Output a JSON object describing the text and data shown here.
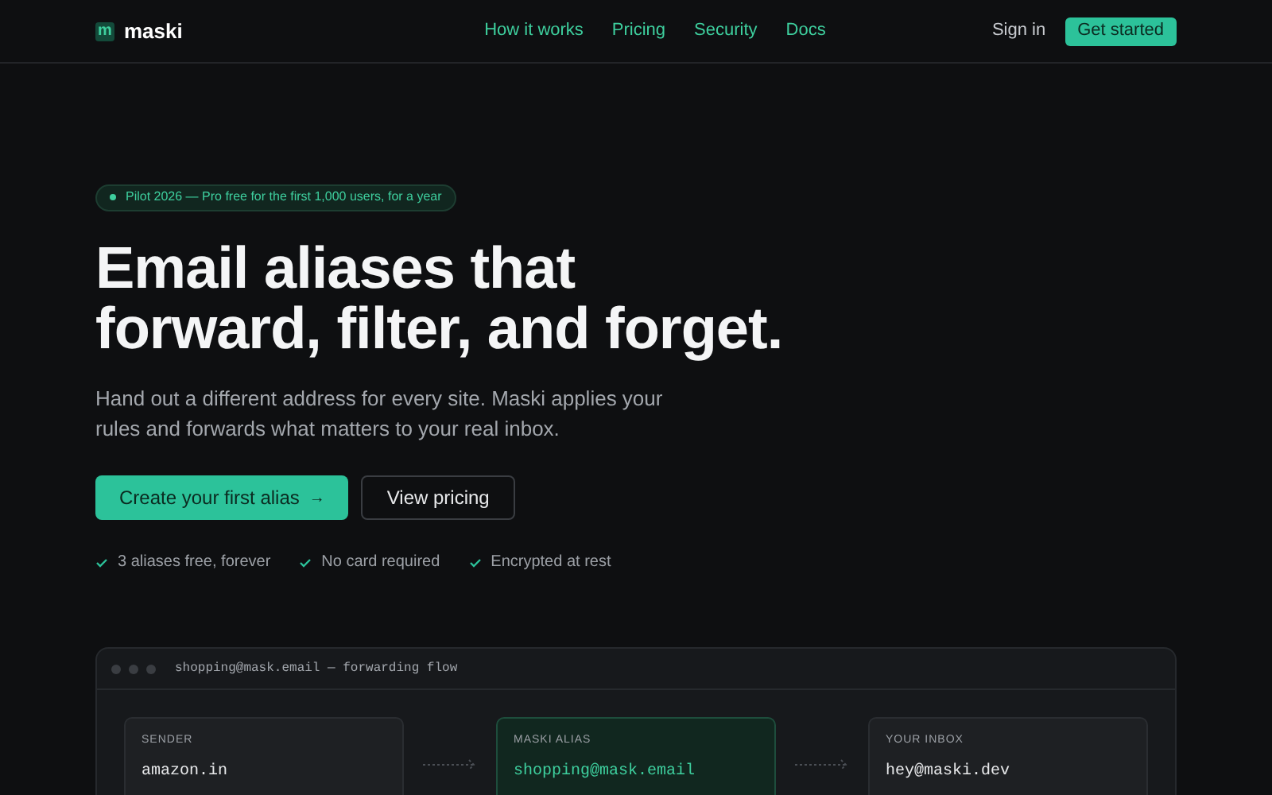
{
  "nav": {
    "logo_mark": "m",
    "brand": "maski",
    "links": [
      "How it works",
      "Pricing",
      "Security",
      "Docs"
    ],
    "sign_in": "Sign in",
    "cta": "Get started"
  },
  "hero": {
    "badge": "Pilot 2026 — Pro free for the first 1,000 users, for a year",
    "title_lines": [
      "Email aliases that",
      "forward, filter, and forget."
    ],
    "subtitle_lines": [
      "Hand out a different address for every site. Maski applies your",
      "rules and forwards what matters to your real inbox."
    ],
    "primary_button": {
      "label": "Create your first alias",
      "arrow": "→"
    },
    "secondary_button": "View pricing",
    "checks": [
      "3 aliases free, forever",
      "No card required",
      "Encrypted at rest"
    ]
  },
  "flow_panel": {
    "title": "shopping@mask.email — forwarding flow",
    "cards": [
      {
        "label": "SENDER",
        "value": "amazon.in",
        "highlighted": false
      },
      {
        "label": "MASKI ALIAS",
        "value": "shopping@mask.email",
        "highlighted": true
      },
      {
        "label": "YOUR INBOX",
        "value": "hey@maski.dev",
        "highlighted": false
      }
    ]
  }
}
